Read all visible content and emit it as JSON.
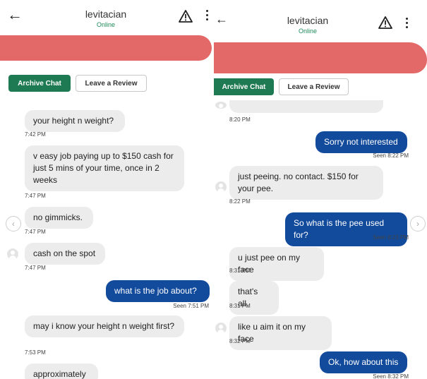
{
  "left": {
    "header": {
      "title": "levitacian",
      "status": "Online"
    },
    "buttons": {
      "archive": "Archive Chat",
      "review": "Leave a Review"
    },
    "messages": [
      {
        "text": "your height n weight?",
        "time": "7:42 PM"
      },
      {
        "text": "v easy job paying up to $150 cash for just 5 mins of your time, once in 2 weeks",
        "time": "7:47 PM"
      },
      {
        "text": "no gimmicks.",
        "time": "7:47 PM"
      },
      {
        "text": "cash on the spot",
        "time": "7:47 PM"
      },
      {
        "text": "what is the job about?",
        "time": "Seen  7:51 PM"
      },
      {
        "text": "may i know your height n weight first?",
        "time": "7:53 PM"
      },
      {
        "text": "approximately",
        "time": ""
      }
    ]
  },
  "right": {
    "header": {
      "title": "levitacian",
      "status": "Online"
    },
    "buttons": {
      "archive": "Archive Chat",
      "review": "Leave a Review"
    },
    "messages": [
      {
        "text": "",
        "time": "8:20 PM"
      },
      {
        "text": "Sorry not interested",
        "time": "Seen  8:22 PM"
      },
      {
        "text": "just peeing. no contact. $150 for your pee.",
        "time": "8:22 PM"
      },
      {
        "text": "So what is the pee used for?",
        "time": "Seen  8:23 PM"
      },
      {
        "text": "u just pee on my face",
        "time": "8:31 PM"
      },
      {
        "text": "that's all.",
        "time": "8:31 PM"
      },
      {
        "text": "like u aim it on my face",
        "time": "8:32 PM"
      },
      {
        "text": "Ok, how about this",
        "time": "Seen  8:32 PM"
      }
    ]
  },
  "icons": {
    "back": "arrow-left-icon",
    "warning": "warning-triangle-icon",
    "menu": "kebab-menu-icon",
    "avatar": "avatar-icon",
    "prev": "chevron-left-icon",
    "next": "chevron-right-icon"
  },
  "colors": {
    "accent_green": "#1e7a52",
    "online_green": "#1f8a5b",
    "outgoing_blue": "#124a9c",
    "incoming_gray": "#ececec",
    "redaction": "#e36868"
  }
}
